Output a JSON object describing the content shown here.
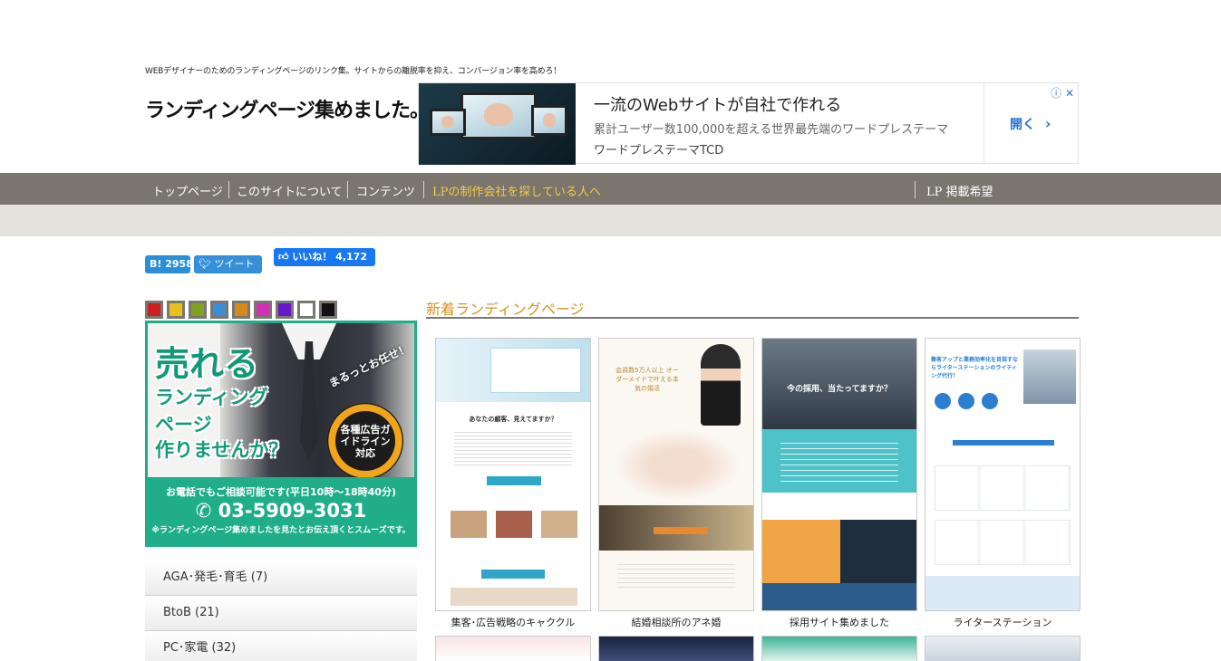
{
  "header": {
    "tagline": "WEBデザイナーのためのランディングページのリンク集。サイトからの離脱率を抑え、コンバージョン率を高めろ！",
    "logo": "ランディングページ集めました。"
  },
  "ad": {
    "title": "一流のWebサイトが自社で作れる",
    "subtitle": "累計ユーザー数100,000を超える世界最先端のワードプレステーマ",
    "brand": "ワードプレステーマTCD",
    "open_label": "開く",
    "open_icon": "chevron-right-icon",
    "info_close": "ⓘ ✕"
  },
  "nav": {
    "items": [
      {
        "label": "トップページ"
      },
      {
        "label": "このサイトについて"
      },
      {
        "label": "コンテンツ"
      },
      {
        "label": "LPの制作会社を探している人へ"
      }
    ],
    "right_label": "LP 掲載希望",
    "bar_color": "#7a756d",
    "highlight_color": "#f6c94a"
  },
  "share": {
    "hatena": "B! 2958",
    "tweet": "ツイート",
    "like": "いいね！ 4,172"
  },
  "swatches": [
    "#cc1f1f",
    "#e8c21a",
    "#7fa21e",
    "#3a8ed8",
    "#d68a1a",
    "#d12fb6",
    "#6a17c9",
    "#ffffff",
    "#111111"
  ],
  "banner": {
    "line1": "売れる",
    "line2": "ランディング",
    "line3": "ページ",
    "line4": "作りませんか？",
    "round": "まるっとお任せ！",
    "badge": "各種広告ガイドライン対応",
    "tel_note": "お電話でもご相談可能です(平日10時〜18時40分)",
    "tel": "03-5909-3031",
    "tel_sub": "※ランディングページ集めましたを見たとお伝え頂くとスムーズです。",
    "accent": "#1fae89"
  },
  "categories": [
    {
      "label": "AGA･発毛･育毛 (7)"
    },
    {
      "label": "BtoB (21)"
    },
    {
      "label": "PC･家電 (32)"
    }
  ],
  "section": {
    "title": "新着ランディングページ",
    "title_color": "#d6941e"
  },
  "cards": [
    {
      "caption": "集客･広告戦略のキャククル",
      "headline": "あなたの顧客、見えてますか？",
      "theme": "#2fa6c8"
    },
    {
      "caption": "結婚相談所のアネ婚",
      "headline": "会員数5万人以上 オーダーメイドで叶える本気の婚活",
      "theme": "#e7c98a"
    },
    {
      "caption": "採用サイト集めました",
      "headline": "今の採用、当たってますか？",
      "theme": "#4ec2c9"
    },
    {
      "caption": "ライターステーション",
      "headline": "集客アップと業務効率化を目指すならライターステーションのライティング代行！",
      "theme": "#2a7fd0"
    }
  ]
}
